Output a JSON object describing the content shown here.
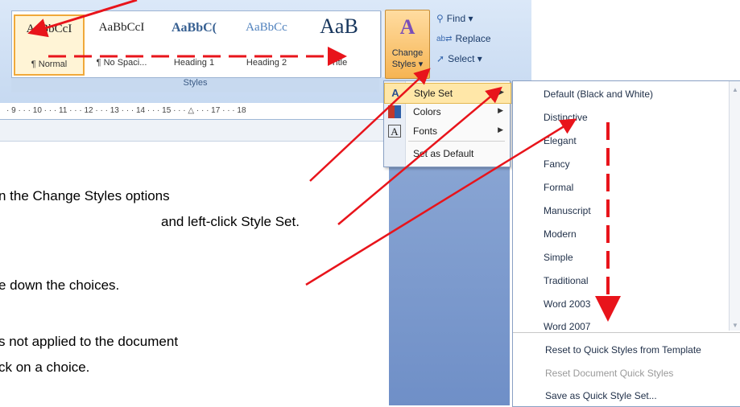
{
  "ribbon": {
    "gallery": {
      "tiles": [
        {
          "sample": "AaBbCcI",
          "label": "¶ Normal"
        },
        {
          "sample": "AaBbCcI",
          "label": "¶ No Spaci..."
        },
        {
          "sample": "AaBbC(",
          "label": "Heading 1"
        },
        {
          "sample": "AaBbCc",
          "label": "Heading 2"
        },
        {
          "sample": "AaB",
          "label": "Title"
        }
      ],
      "group_label": "Styles"
    },
    "change_styles": {
      "label_line1": "Change",
      "label_line2": "Styles ▾"
    },
    "editing": {
      "find": "Find ▾",
      "replace": "Replace",
      "select": "Select ▾"
    }
  },
  "ruler_text": "· 9 · · · 10 · · · 11 · · · 12 · · · 13 · · · 14 · · · 15 · · · △ · · · 17 · · · 18",
  "submenu": {
    "items": [
      "Style Set",
      "Colors",
      "Fonts",
      "Set as Default"
    ]
  },
  "style_set_menu": {
    "items": [
      "Default (Black and White)",
      "Distinctive",
      "Elegant",
      "Fancy",
      "Formal",
      "Manuscript",
      "Modern",
      "Simple",
      "Traditional",
      "Word 2003",
      "Word 2007"
    ],
    "bottom": {
      "reset_quick": "Reset to Quick Styles from Template",
      "reset_document": "Reset Document Quick Styles",
      "save_as": "Save as Quick Style Set..."
    }
  },
  "instructions": {
    "line1": "n the Change Styles options",
    "line2": "and left-click Style Set.",
    "line3": "e down the choices.",
    "line4": "s not applied to the document",
    "line5": "ck on a choice."
  },
  "colors": {
    "annotation": "#e8141b"
  }
}
